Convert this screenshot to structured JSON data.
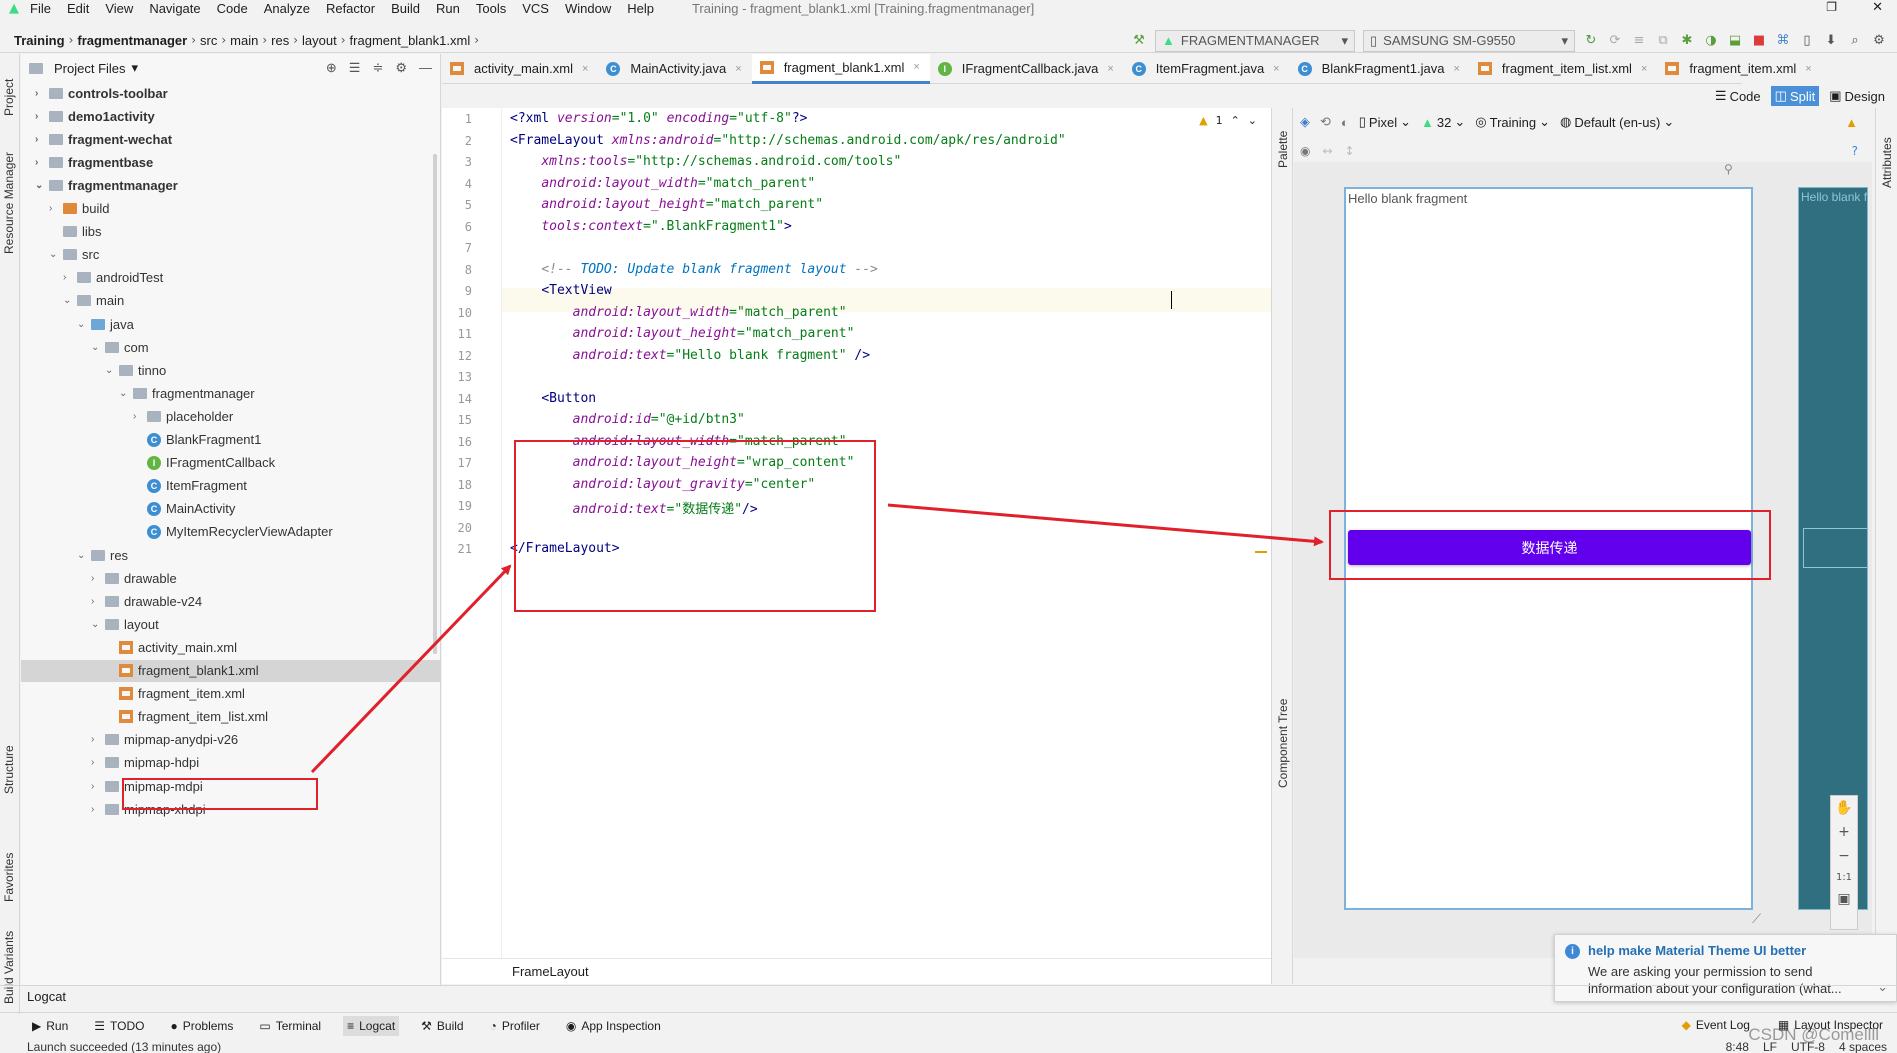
{
  "menu": {
    "items": [
      "File",
      "Edit",
      "View",
      "Navigate",
      "Code",
      "Analyze",
      "Refactor",
      "Build",
      "Run",
      "Tools",
      "VCS",
      "Window",
      "Help"
    ],
    "window_title": "Training - fragment_blank1.xml [Training.fragmentmanager]"
  },
  "breadcrumb": [
    "Training",
    "fragmentmanager",
    "src",
    "main",
    "res",
    "layout",
    "fragment_blank1.xml"
  ],
  "toolbar": {
    "run_config": "FRAGMENTMANAGER",
    "device": "SAMSUNG SM-G9550"
  },
  "left_strip": [
    "Project",
    "Resource Manager",
    "Structure",
    "Favorites",
    "Build Variants"
  ],
  "project": {
    "header": "Project Files",
    "tree": [
      {
        "label": "controls-toolbar",
        "bold": true,
        "indent": 0,
        "arrow": "›",
        "icon": "folder"
      },
      {
        "label": "demo1activity",
        "bold": true,
        "indent": 0,
        "arrow": "›",
        "icon": "folder"
      },
      {
        "label": "fragment-wechat",
        "bold": true,
        "indent": 0,
        "arrow": "›",
        "icon": "folder"
      },
      {
        "label": "fragmentbase",
        "bold": true,
        "indent": 0,
        "arrow": "›",
        "icon": "folder"
      },
      {
        "label": "fragmentmanager",
        "bold": true,
        "indent": 0,
        "arrow": "⌄",
        "icon": "folder"
      },
      {
        "label": "build",
        "bold": false,
        "indent": 1,
        "arrow": "›",
        "icon": "folder-orange"
      },
      {
        "label": "libs",
        "bold": false,
        "indent": 1,
        "arrow": "",
        "icon": "folder"
      },
      {
        "label": "src",
        "bold": false,
        "indent": 1,
        "arrow": "⌄",
        "icon": "folder"
      },
      {
        "label": "androidTest",
        "bold": false,
        "indent": 2,
        "arrow": "›",
        "icon": "folder"
      },
      {
        "label": "main",
        "bold": false,
        "indent": 2,
        "arrow": "⌄",
        "icon": "folder"
      },
      {
        "label": "java",
        "bold": false,
        "indent": 3,
        "arrow": "⌄",
        "icon": "folder-blue"
      },
      {
        "label": "com",
        "bold": false,
        "indent": 4,
        "arrow": "⌄",
        "icon": "folder"
      },
      {
        "label": "tinno",
        "bold": false,
        "indent": 5,
        "arrow": "⌄",
        "icon": "folder"
      },
      {
        "label": "fragmentmanager",
        "bold": false,
        "indent": 6,
        "arrow": "⌄",
        "icon": "folder"
      },
      {
        "label": "placeholder",
        "bold": false,
        "indent": 7,
        "arrow": "›",
        "icon": "folder"
      },
      {
        "label": "BlankFragment1",
        "bold": false,
        "indent": 7,
        "arrow": "",
        "icon": "class"
      },
      {
        "label": "IFragmentCallback",
        "bold": false,
        "indent": 7,
        "arrow": "",
        "icon": "interface"
      },
      {
        "label": "ItemFragment",
        "bold": false,
        "indent": 7,
        "arrow": "",
        "icon": "class"
      },
      {
        "label": "MainActivity",
        "bold": false,
        "indent": 7,
        "arrow": "",
        "icon": "class"
      },
      {
        "label": "MyItemRecyclerViewAdapter",
        "bold": false,
        "indent": 7,
        "arrow": "",
        "icon": "class"
      },
      {
        "label": "res",
        "bold": false,
        "indent": 3,
        "arrow": "⌄",
        "icon": "folder"
      },
      {
        "label": "drawable",
        "bold": false,
        "indent": 4,
        "arrow": "›",
        "icon": "folder"
      },
      {
        "label": "drawable-v24",
        "bold": false,
        "indent": 4,
        "arrow": "›",
        "icon": "folder"
      },
      {
        "label": "layout",
        "bold": false,
        "indent": 4,
        "arrow": "⌄",
        "icon": "folder"
      },
      {
        "label": "activity_main.xml",
        "bold": false,
        "indent": 5,
        "arrow": "",
        "icon": "xml"
      },
      {
        "label": "fragment_blank1.xml",
        "bold": false,
        "indent": 5,
        "arrow": "",
        "icon": "xml",
        "selected": true
      },
      {
        "label": "fragment_item.xml",
        "bold": false,
        "indent": 5,
        "arrow": "",
        "icon": "xml"
      },
      {
        "label": "fragment_item_list.xml",
        "bold": false,
        "indent": 5,
        "arrow": "",
        "icon": "xml"
      },
      {
        "label": "mipmap-anydpi-v26",
        "bold": false,
        "indent": 4,
        "arrow": "›",
        "icon": "folder"
      },
      {
        "label": "mipmap-hdpi",
        "bold": false,
        "indent": 4,
        "arrow": "›",
        "icon": "folder"
      },
      {
        "label": "mipmap-mdpi",
        "bold": false,
        "indent": 4,
        "arrow": "›",
        "icon": "folder"
      },
      {
        "label": "mipmap-xhdpi",
        "bold": false,
        "indent": 4,
        "arrow": "›",
        "icon": "folder"
      }
    ]
  },
  "editor_tabs": [
    {
      "label": "activity_main.xml",
      "icon": "xml",
      "active": false
    },
    {
      "label": "MainActivity.java",
      "icon": "class",
      "active": false
    },
    {
      "label": "fragment_blank1.xml",
      "icon": "xml",
      "active": true
    },
    {
      "label": "IFragmentCallback.java",
      "icon": "interface",
      "active": false
    },
    {
      "label": "ItemFragment.java",
      "icon": "class",
      "active": false
    },
    {
      "label": "BlankFragment1.java",
      "icon": "class",
      "active": false
    },
    {
      "label": "fragment_item_list.xml",
      "icon": "xml",
      "active": false
    },
    {
      "label": "fragment_item.xml",
      "icon": "xml",
      "active": false
    }
  ],
  "view_modes": [
    "Code",
    "Split",
    "Design"
  ],
  "editor": {
    "warning_count": "1",
    "lines": [
      {
        "n": "1",
        "html": "<span class='tag'>&lt;?xml </span><span class='attr'>version</span><span class='val'>=\"1.0\" </span><span class='attr'>encoding</span><span class='val'>=\"utf-8\"</span><span class='tag'>?&gt;</span>"
      },
      {
        "n": "2",
        "html": "<span class='tag'>&lt;FrameLayout </span><span class='attr'>xmlns:android</span><span class='val'>=\"http://schemas.android.com/apk/res/android\"</span>"
      },
      {
        "n": "3",
        "html": "    <span class='attr'>xmlns:tools</span><span class='val'>=\"http://schemas.android.com/tools\"</span>"
      },
      {
        "n": "4",
        "html": "    <span class='attr'>android:layout_width</span><span class='val'>=\"match_parent\"</span>"
      },
      {
        "n": "5",
        "html": "    <span class='attr'>android:layout_height</span><span class='val'>=\"match_parent\"</span>"
      },
      {
        "n": "6",
        "html": "    <span class='attr'>tools:context</span><span class='val'>=\".BlankFragment1\"</span><span class='tag'>&gt;</span>"
      },
      {
        "n": "7",
        "html": ""
      },
      {
        "n": "8",
        "html": "    <span class='comment'>&lt;!-- </span><span class='todo'>TODO: Update blank fragment layout</span><span class='comment'> --&gt;</span>"
      },
      {
        "n": "9",
        "html": "    <span class='tag'>&lt;TextView</span>"
      },
      {
        "n": "10",
        "html": "        <span class='attr'>android:layout_width</span><span class='val'>=\"match_parent\"</span>"
      },
      {
        "n": "11",
        "html": "        <span class='attr'>android:layout_height</span><span class='val'>=\"match_parent\"</span>"
      },
      {
        "n": "12",
        "html": "        <span class='attr'>android:text</span><span class='val'>=\"Hello blank fragment\"</span> <span class='tag'>/&gt;</span>"
      },
      {
        "n": "13",
        "html": ""
      },
      {
        "n": "14",
        "html": "    <span class='tag'>&lt;Button</span>"
      },
      {
        "n": "15",
        "html": "        <span class='attr'>android:id</span><span class='val'>=\"@+id/btn3\"</span>"
      },
      {
        "n": "16",
        "html": "        <span class='attr'>android:layout_width</span><span class='val'>=\"match_parent\"</span>"
      },
      {
        "n": "17",
        "html": "        <span class='attr'>android:layout_height</span><span class='val'>=\"wrap_content\"</span>"
      },
      {
        "n": "18",
        "html": "        <span class='attr'>android:layout_gravity</span><span class='val'>=\"center\"</span>"
      },
      {
        "n": "19",
        "html": "        <span class='attr'>android:text</span><span class='val'>=\"数据传递\"</span><span class='tag'>/&gt;</span>"
      },
      {
        "n": "20",
        "html": ""
      },
      {
        "n": "21",
        "html": "<span class='tag'>&lt;/FrameLayout&gt;</span>"
      }
    ],
    "breadcrumb": "FrameLayout"
  },
  "design": {
    "device": "Pixel",
    "api": "32",
    "theme": "Training",
    "locale": "Default (en-us)",
    "hello_text": "Hello blank fragment",
    "button_text": "数据传递",
    "blueprint_text": "Hello blank fr",
    "zoom_label": "1:1"
  },
  "side_tabs": {
    "palette": "Palette",
    "component_tree": "Component Tree",
    "attributes": "Attributes"
  },
  "notification": {
    "title": "help make Material Theme UI better",
    "body": "We are asking your permission to send information about your configuration (what..."
  },
  "logcat_title": "Logcat",
  "bottom_tabs": [
    {
      "label": "Run",
      "icon": "▶"
    },
    {
      "label": "TODO",
      "icon": "☰"
    },
    {
      "label": "Problems",
      "icon": "●"
    },
    {
      "label": "Terminal",
      "icon": "▭"
    },
    {
      "label": "Logcat",
      "icon": "≡",
      "active": true
    },
    {
      "label": "Build",
      "icon": "⚒"
    },
    {
      "label": "Profiler",
      "icon": "◔"
    },
    {
      "label": "App Inspection",
      "icon": "◉"
    }
  ],
  "bottom_right": [
    "Event Log",
    "Layout Inspector"
  ],
  "status": {
    "message": "Launch succeeded (13 minutes ago)",
    "position": "8:48",
    "col": "LF",
    "encoding": "UTF-8",
    "indent": "4 spaces"
  },
  "watermark": "CSDN @Comellll",
  "colors": {
    "accent": "#4083c9",
    "button": "#6200ee",
    "annotation": "#e0202a",
    "blueprint": "#2f6f80"
  }
}
